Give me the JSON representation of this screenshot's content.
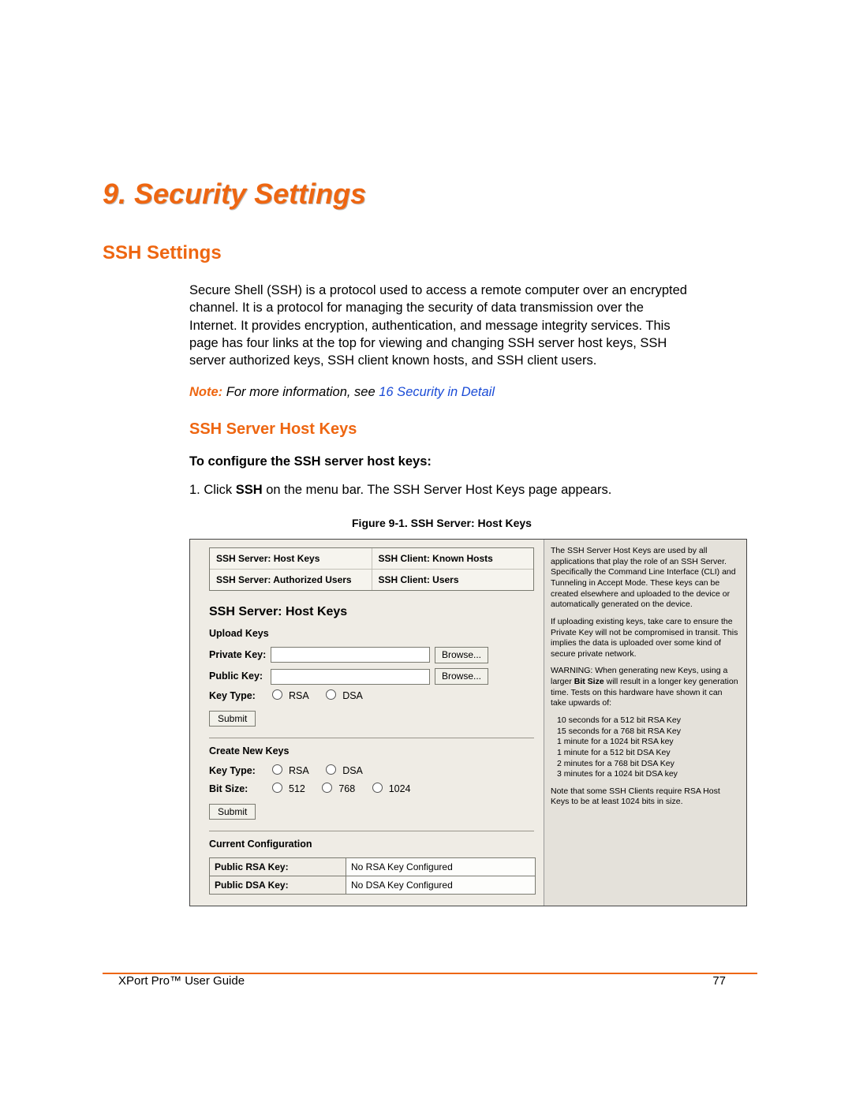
{
  "chapter": "9. Security Settings",
  "h2": "SSH Settings",
  "intro": "Secure Shell (SSH) is a protocol used to access a remote computer over an encrypted channel. It is a protocol for managing the security of data transmission over the Internet. It provides encryption, authentication, and message integrity services. This page has four links at the top for viewing and changing SSH server host keys, SSH server authorized keys, SSH client known hosts, and SSH client users.",
  "note_word": "Note:",
  "note_text": " For more information, see ",
  "note_link": "16 Security in Detail",
  "h3": "SSH Server Host Keys",
  "bold_intro": "To configure the SSH server host keys:",
  "step1_a": "1.   Click ",
  "step1_b": "SSH",
  "step1_c": " on the menu bar. The SSH Server Host Keys page appears.",
  "figcap": "Figure 9-1. SSH Server: Host Keys",
  "tabs": {
    "r1c1": "SSH Server: Host Keys",
    "r1c2": "SSH Client: Known Hosts",
    "r2c1": "SSH Server: Authorized Users",
    "r2c2": "SSH Client: Users"
  },
  "panel_h": "SSH Server: Host Keys",
  "upload_h": "Upload Keys",
  "labels": {
    "private": "Private Key:",
    "public": "Public Key:",
    "keytype": "Key Type:",
    "bitsize": "Bit Size:"
  },
  "radios": {
    "rsa": "RSA",
    "dsa": "DSA",
    "b512": "512",
    "b768": "768",
    "b1024": "1024"
  },
  "browse": "Browse...",
  "submit": "Submit",
  "create_h": "Create New Keys",
  "current_h": "Current Configuration",
  "cfg": {
    "rsa_l": "Public RSA Key:",
    "rsa_r": "No RSA Key Configured",
    "dsa_l": "Public DSA Key:",
    "dsa_r": "No DSA Key Configured"
  },
  "side": {
    "p1a": "The SSH Server Host Keys are used by all applications that play the role of an SSH Server. Specifically the Command Line Interface (CLI) and Tunneling in Accept Mode. These keys can be created elsewhere and uploaded to the device or automatically generated on the device.",
    "p2": "If uploading existing keys, take care to ensure the Private Key will not be compromised in transit. This implies the data is uploaded over some kind of secure private network.",
    "p3a": "WARNING: When generating new Keys, using a larger ",
    "p3b": "Bit Size",
    "p3c": " will result in a longer key generation time. Tests on this hardware have shown it can take upwards of:",
    "t1": "10 seconds for a 512 bit RSA Key",
    "t2": "15 seconds for a 768 bit RSA Key",
    "t3": "1 minute for a 1024 bit RSA key",
    "t4": "1 minute for a 512 bit DSA Key",
    "t5": "2 minutes for a 768 bit DSA Key",
    "t6": "3 minutes for a 1024 bit DSA key",
    "p4": "Note that some SSH Clients require RSA Host Keys to be at least 1024 bits in size."
  },
  "footer_left": "XPort Pro™ User Guide",
  "footer_right": "77"
}
